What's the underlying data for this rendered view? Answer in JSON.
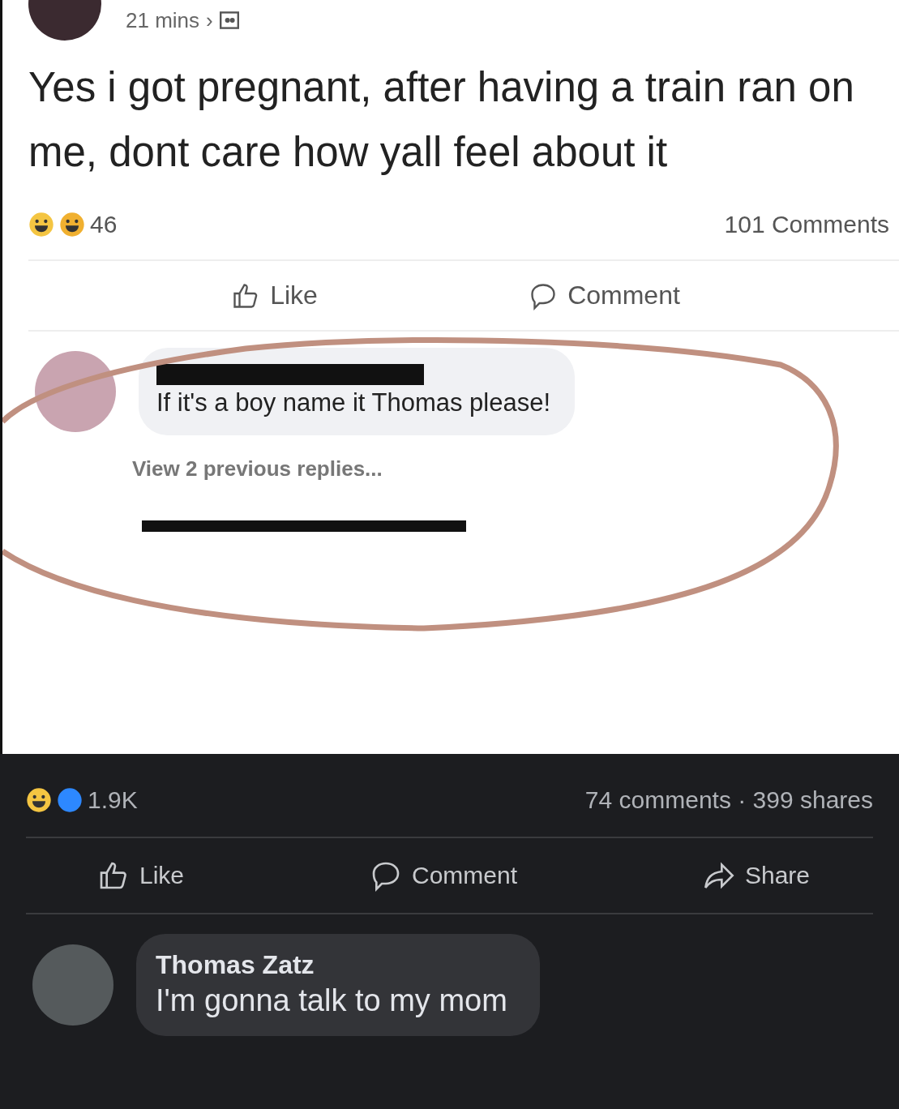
{
  "post": {
    "time": "21 mins",
    "time_separator": "›",
    "text": "Yes i got pregnant, after having a train ran on me, dont care how yall feel about it",
    "reaction_count": "46",
    "comment_count": "101 Comments",
    "actions": [
      {
        "kind": "like",
        "label": "Like"
      },
      {
        "kind": "comment",
        "label": "Comment"
      }
    ],
    "comment": {
      "text": "If it's a boy name it Thomas please!"
    },
    "view_replies": "View 2 previous replies..."
  },
  "shared_post": {
    "reaction_count": "1.9K",
    "stats": "74 comments · 399 shares",
    "actions": [
      {
        "kind": "like",
        "label": "Like"
      },
      {
        "kind": "comment",
        "label": "Comment"
      },
      {
        "kind": "share",
        "label": "Share"
      }
    ],
    "comment": {
      "author": "Thomas Zatz",
      "text": "I'm gonna talk to my mom"
    }
  }
}
